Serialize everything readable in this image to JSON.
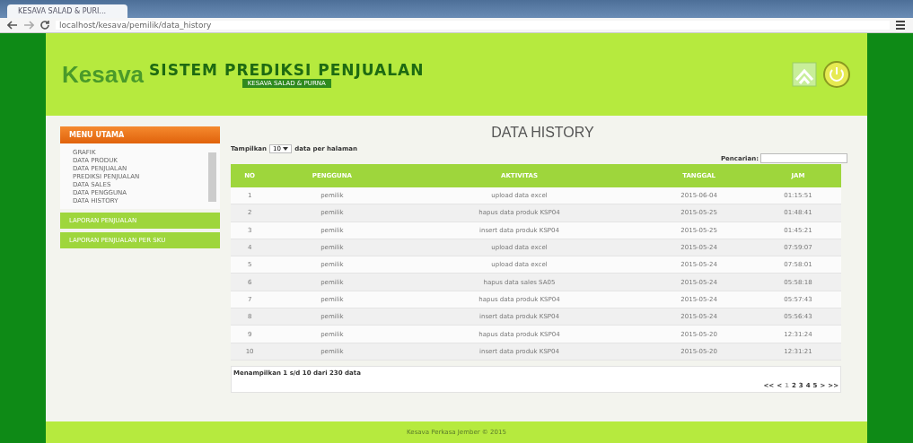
{
  "browser": {
    "tab_title": "KESAVA SALAD & PURI...",
    "address": "localhost/kesava/pemilik/data_history"
  },
  "header": {
    "logo": "Kesava",
    "title": "SISTEM PREDIKSI PENJUALAN",
    "subtitle": "KESAVA SALAD & PURNA"
  },
  "sidebar": {
    "menu_title": "MENU UTAMA",
    "items": [
      "GRAFIK",
      "DATA PRODUK",
      "DATA PENJUALAN",
      "PREDIKSI PENJUALAN",
      "DATA SALES",
      "DATA PENGGUNA",
      "DATA HISTORY"
    ],
    "sections": [
      "LAPORAN PENJUALAN",
      "LAPORAN PENJUALAN PER SKU"
    ]
  },
  "content": {
    "title": "DATA HISTORY",
    "length_label_before": "Tampilkan",
    "length_value": "10",
    "length_label_after": "data per halaman",
    "search_label": "Pencarian:",
    "table": {
      "columns": [
        "NO",
        "PENGGUNA",
        "AKTIVITAS",
        "TANGGAL",
        "JAM"
      ],
      "rows": [
        [
          "1",
          "pemilik",
          "upload data excel",
          "2015-06-04",
          "01:15:51"
        ],
        [
          "2",
          "pemilik",
          "hapus data produk KSP04",
          "2015-05-25",
          "01:48:41"
        ],
        [
          "3",
          "pemilik",
          "insert data produk KSP04",
          "2015-05-25",
          "01:45:21"
        ],
        [
          "4",
          "pemilik",
          "upload data excel",
          "2015-05-24",
          "07:59:07"
        ],
        [
          "5",
          "pemilik",
          "upload data excel",
          "2015-05-24",
          "07:58:01"
        ],
        [
          "6",
          "pemilik",
          "hapus data sales SA05",
          "2015-05-24",
          "05:58:18"
        ],
        [
          "7",
          "pemilik",
          "hapus data produk KSP04",
          "2015-05-24",
          "05:57:43"
        ],
        [
          "8",
          "pemilik",
          "insert data produk KSP04",
          "2015-05-24",
          "05:56:43"
        ],
        [
          "9",
          "pemilik",
          "hapus data produk KSP04",
          "2015-05-20",
          "12:31:24"
        ],
        [
          "10",
          "pemilik",
          "insert data produk KSP04",
          "2015-05-20",
          "12:31:21"
        ]
      ]
    },
    "info": "Menampilkan 1 s/d 10 dari 230 data",
    "pagination": [
      {
        "label": "<<",
        "selected": false
      },
      {
        "label": "<",
        "selected": false
      },
      {
        "label": "1",
        "selected": true
      },
      {
        "label": "2",
        "selected": false
      },
      {
        "label": "3",
        "selected": false
      },
      {
        "label": "4",
        "selected": false
      },
      {
        "label": "5",
        "selected": false
      },
      {
        "label": ">",
        "selected": false
      },
      {
        "label": ">>",
        "selected": false
      }
    ]
  },
  "footer": "Kesava Perkasa Jember © 2015"
}
